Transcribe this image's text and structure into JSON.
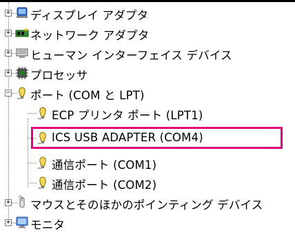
{
  "device_tree": {
    "categories": [
      {
        "label": "ディスプレイ アダプタ",
        "icon": "display-adapter-icon"
      },
      {
        "label": "ネットワーク アダプタ",
        "icon": "network-adapter-icon"
      },
      {
        "label": "ヒューマン インターフェイス デバイス",
        "icon": "human-interface-device-icon"
      },
      {
        "label": "プロセッサ",
        "icon": "processor-icon"
      },
      {
        "label": "ポート (COM と LPT)",
        "icon": "port-icon",
        "expanded": true
      },
      {
        "label": "マウスとそのほかのポインティング デバイス",
        "icon": "mouse-icon"
      },
      {
        "label": "モニタ",
        "icon": "monitor-icon"
      }
    ],
    "port_children": [
      {
        "label": "ECP プリンタ ポート (LPT1)",
        "icon": "port-icon"
      },
      {
        "label": "ICS USB ADAPTER (COM4)",
        "icon": "port-icon",
        "highlighted": true
      },
      {
        "label": "通信ポート (COM1)",
        "icon": "port-icon"
      },
      {
        "label": "通信ポート (COM2)",
        "icon": "port-icon"
      }
    ],
    "expander_symbols": {
      "collapsed": "+",
      "expanded": "−"
    },
    "highlight_color": "#e0007a"
  }
}
